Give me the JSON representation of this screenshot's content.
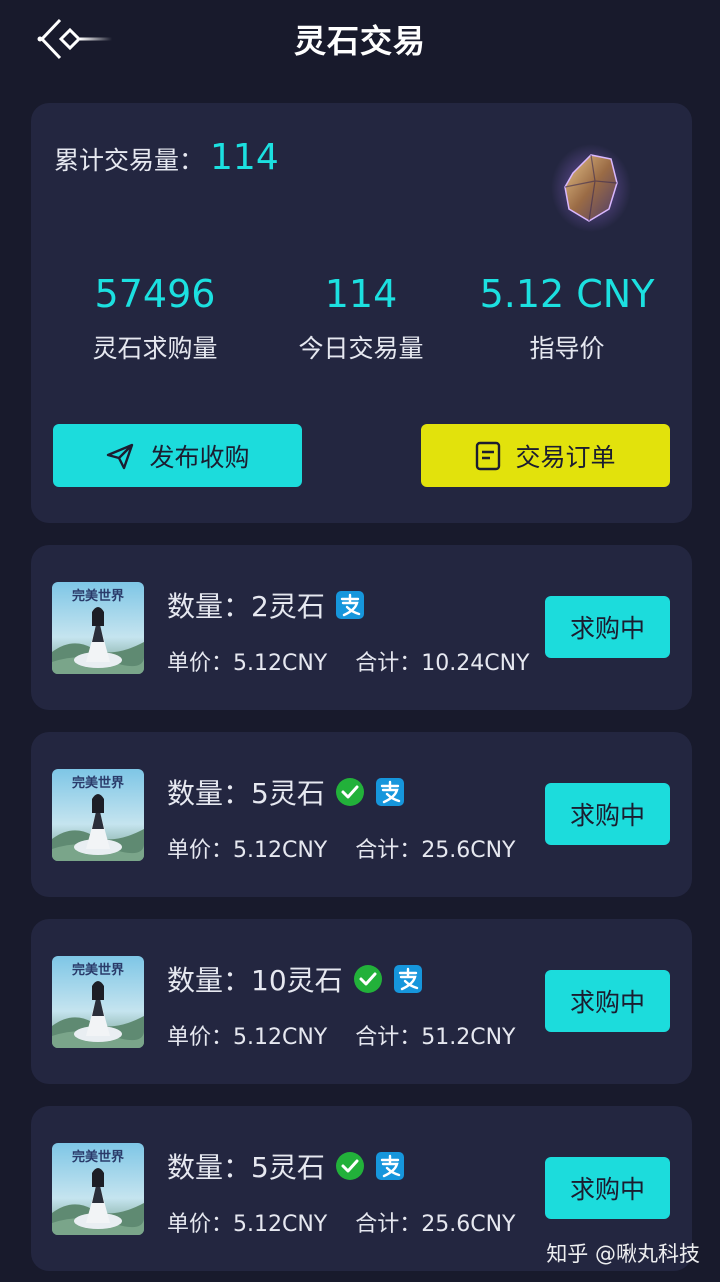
{
  "header": {
    "title": "灵石交易"
  },
  "summary": {
    "total_label": "累计交易量：",
    "total_value": "114",
    "stats": [
      {
        "value": "57496",
        "label": "灵石求购量"
      },
      {
        "value": "114",
        "label": "今日交易量"
      },
      {
        "value": "5.12 CNY",
        "label": "指导价"
      }
    ],
    "publish_label": "发布收购",
    "orders_label": "交易订单"
  },
  "orders": [
    {
      "qty": "数量：2灵石",
      "unit_price": "单价：5.12CNY",
      "total": "合计：10.24CNY",
      "status": "求购中",
      "pay": [
        "alipay-icon"
      ]
    },
    {
      "qty": "数量：5灵石",
      "unit_price": "单价：5.12CNY",
      "total": "合计：25.6CNY",
      "status": "求购中",
      "pay": [
        "wechat-icon",
        "alipay-icon"
      ]
    },
    {
      "qty": "数量：10灵石",
      "unit_price": "单价：5.12CNY",
      "total": "合计：51.2CNY",
      "status": "求购中",
      "pay": [
        "wechat-icon",
        "alipay-icon"
      ]
    },
    {
      "qty": "数量：5灵石",
      "unit_price": "单价：5.12CNY",
      "total": "合计：25.6CNY",
      "status": "求购中",
      "pay": [
        "wechat-icon",
        "alipay-icon"
      ]
    }
  ],
  "thumb_caption": "完美世界",
  "watermark": "知乎 @啾丸科技",
  "colors": {
    "accent": "#1cdcdc",
    "yellow": "#e2e20c",
    "card": "#232640",
    "bg": "#181a2c"
  }
}
